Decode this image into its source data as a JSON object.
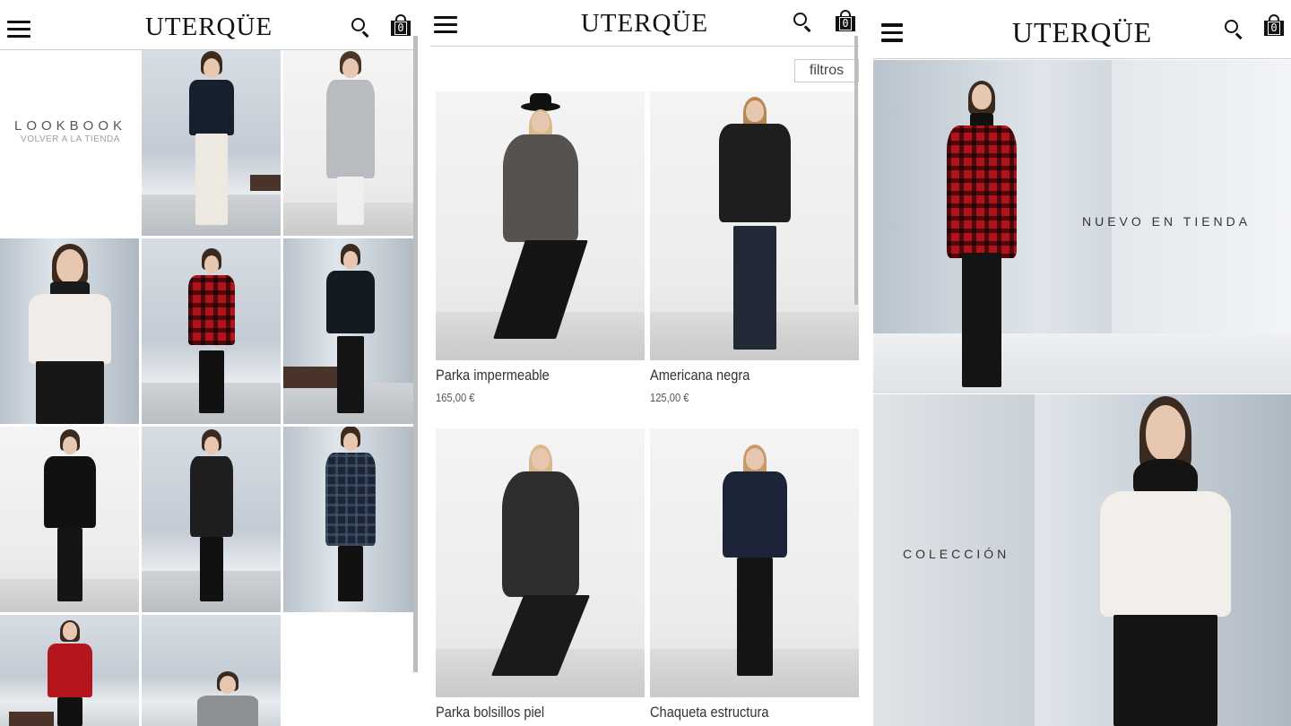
{
  "brand": {
    "logo": "UTERQÜE",
    "cart_count": "0"
  },
  "lookbook_panel": {
    "title": "LOOKBOOK",
    "back_link": "VOLVER A LA TIENDA"
  },
  "catalog_panel": {
    "filter_button": "filtros",
    "products": [
      {
        "name": "Parka impermeable",
        "price": "165,00 €"
      },
      {
        "name": "Americana negra",
        "price": "125,00 €"
      },
      {
        "name": "Parka bolsillos piel",
        "price": ""
      },
      {
        "name": "Chaqueta estructura",
        "price": ""
      }
    ]
  },
  "home_panel": {
    "banners": [
      {
        "label": "NUEVO EN TIENDA"
      },
      {
        "label": "COLECCIÓN"
      }
    ]
  },
  "icons": [
    "menu-icon",
    "search-icon",
    "shopping-bag-icon"
  ]
}
